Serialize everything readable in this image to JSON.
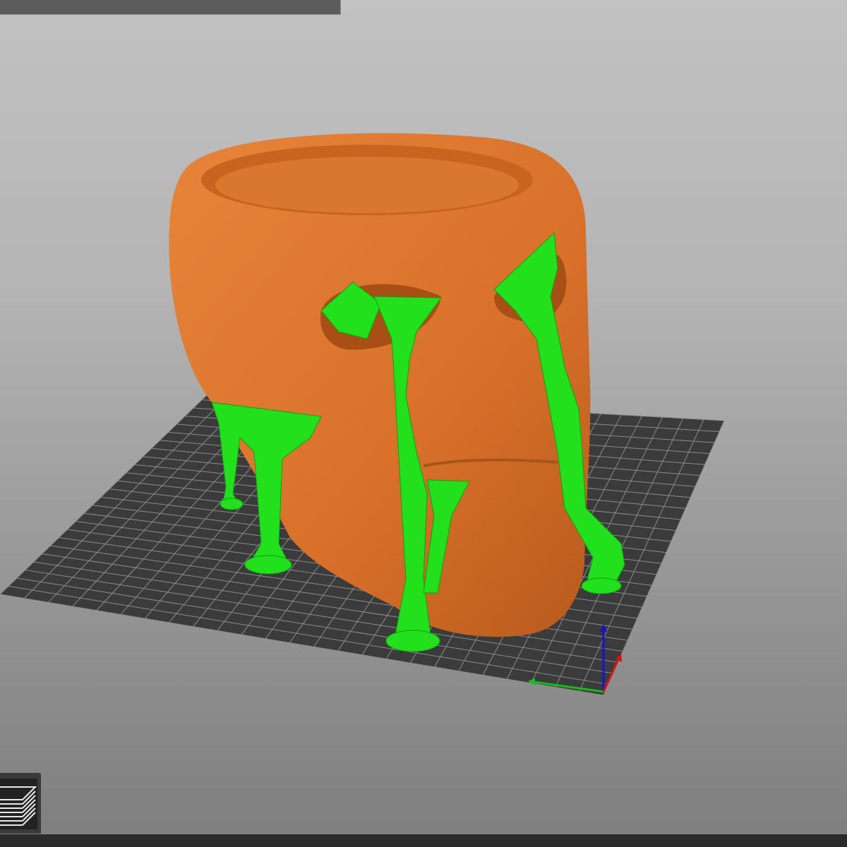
{
  "app": {
    "view": "3d-preview"
  },
  "colors": {
    "model": "#e0782c",
    "supports": "#1fe01a",
    "bed": "#3a3a3a",
    "bed_grid": "#8c8c8c",
    "axis_x": "#d01010",
    "axis_y": "#10c010",
    "axis_z": "#1010d0"
  },
  "toolbar": {
    "layers_icon": "layers-icon"
  }
}
